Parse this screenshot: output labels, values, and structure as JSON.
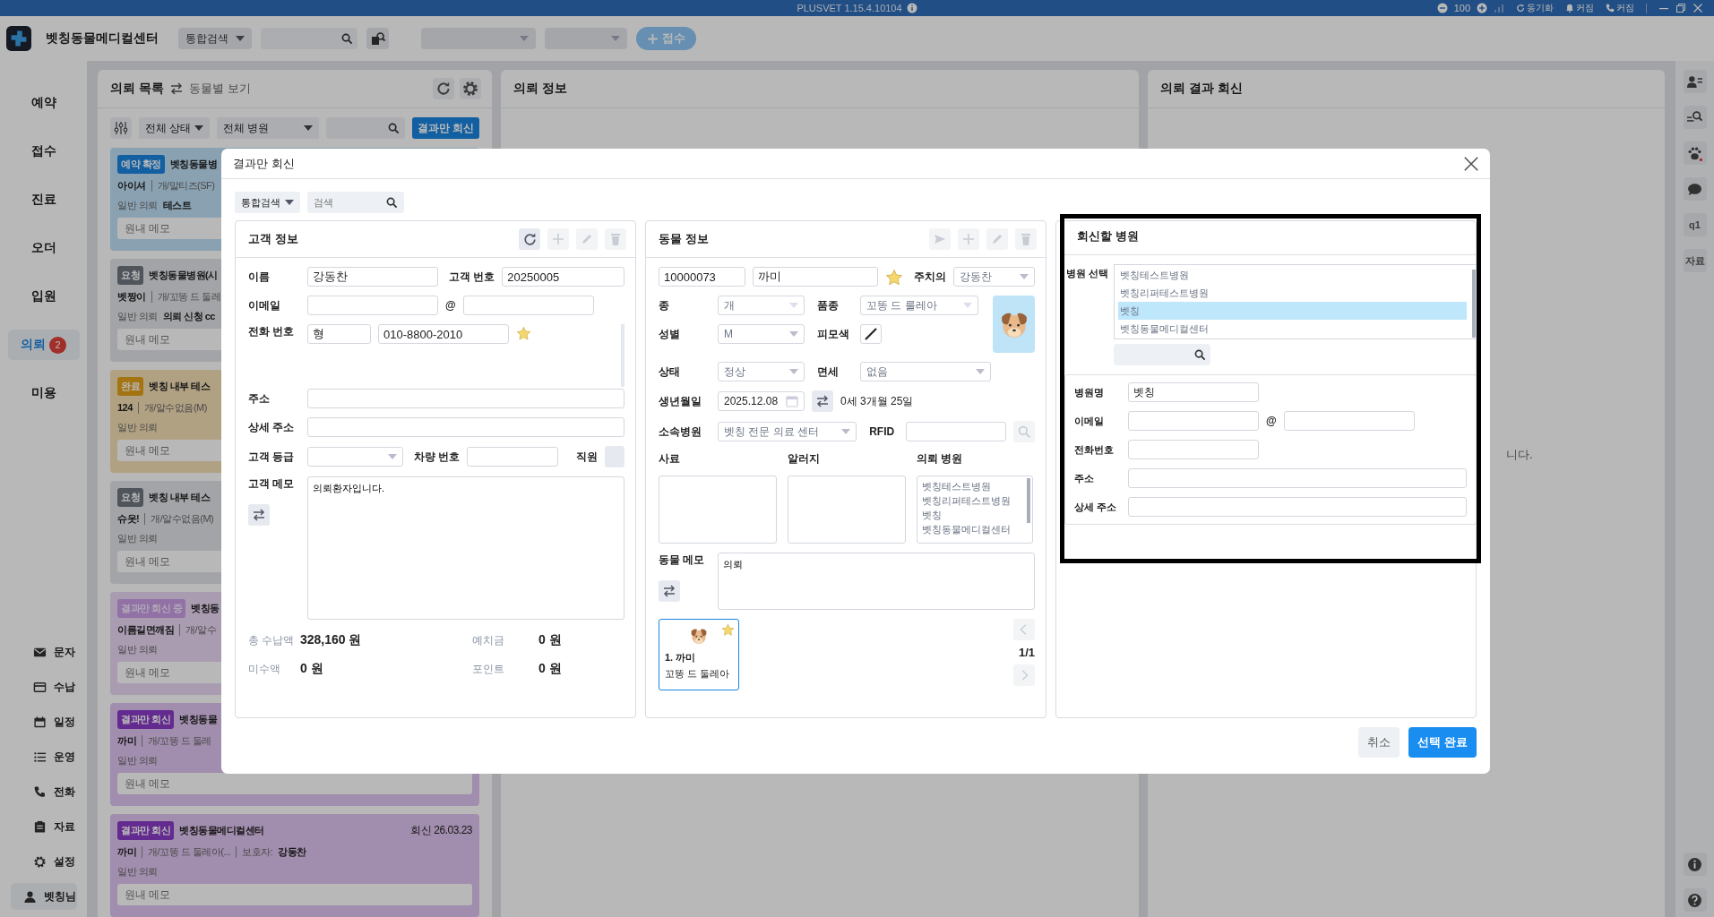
{
  "titlebar": {
    "title": "PLUSVET 1.15.4.10104",
    "zoom": "100",
    "items": [
      {
        "kind": "sync",
        "label": "동기화"
      },
      {
        "kind": "bell",
        "label": "커짐"
      },
      {
        "kind": "phone",
        "label": "커짐"
      }
    ]
  },
  "header": {
    "clinic": "벳칭동물메디컬센터",
    "search_mode": "통합검색",
    "receive_button": "접수"
  },
  "nav": {
    "items": [
      {
        "label": "예약",
        "selected": false
      },
      {
        "label": "접수",
        "selected": false
      },
      {
        "label": "진료",
        "selected": false
      },
      {
        "label": "오더",
        "selected": false
      },
      {
        "label": "입원",
        "selected": false
      },
      {
        "label": "의뢰",
        "selected": true,
        "badge": "2"
      },
      {
        "label": "미용",
        "selected": false
      }
    ],
    "tools": [
      {
        "kind": "mail",
        "label": "문자"
      },
      {
        "kind": "card",
        "label": "수납"
      },
      {
        "kind": "calendar",
        "label": "일정"
      },
      {
        "kind": "list",
        "label": "운영"
      },
      {
        "kind": "phone",
        "label": "전화"
      },
      {
        "kind": "doc",
        "label": "자료"
      },
      {
        "kind": "gear",
        "label": "설정"
      }
    ],
    "user": "벳칭님"
  },
  "list_panel": {
    "title": "의뢰 목록",
    "toggle": "동물별 보기",
    "filters": [
      "전체 상태",
      "전체 병원"
    ],
    "action": "결과만 회신",
    "cards": [
      {
        "kind": "confirmed",
        "status": "예약 확정",
        "hospital": "벳칭동물병",
        "pet": "아이셔",
        "species": "개/말티즈(SF)",
        "type": "일반 의뢰",
        "note": "테스트",
        "memo": "원내 메모"
      },
      {
        "kind": "request",
        "status": "요청",
        "hospital": "벳칭동물병원(시",
        "pet": "벳짱이",
        "species": "개/꼬똥 드 둘레",
        "type": "일반 의뢰",
        "note": "의뢰 신청 cc",
        "memo": "원내 메모"
      },
      {
        "kind": "done",
        "status": "완료",
        "hospital": "벳칭 내부 테스",
        "pet": "124",
        "species": "개/알수없음(M)",
        "type": "일반 의뢰",
        "memo": "원내 메모"
      },
      {
        "kind": "request",
        "status": "요청",
        "hospital": "벳칭 내부 테스",
        "pet": "슈웃!",
        "species": "개/알수없음(M)",
        "type": "일반 의뢰",
        "memo": "원내 메모"
      },
      {
        "kind": "pending",
        "status": "결과만 회신 중",
        "hospital": "벳칭동",
        "pet": "이름길면깨짐",
        "species": "개/알수",
        "type": "일반 의뢰",
        "memo": "원내 메모"
      },
      {
        "kind": "reply",
        "status": "결과만 회신",
        "hospital": "벳칭동물",
        "pet": "까미",
        "species": "개/꼬똥 드 둘레",
        "type": "일반 의뢰",
        "memo": "원내 메모"
      },
      {
        "kind": "reply",
        "status": "결과만 회신",
        "hospital": "벳칭동물메디컬센터",
        "date": "회신 26.03.23",
        "pet": "까미",
        "species": "개/꼬똥 드 둘레아(...",
        "owner_label": "보호자:",
        "owner": "강동찬",
        "type": "일반 의뢰",
        "memo": "원내 메모"
      }
    ]
  },
  "info_panel": {
    "title": "의뢰 정보"
  },
  "result_panel": {
    "title": "의뢰 결과 회신",
    "message": "니다."
  },
  "side_tools": [
    {
      "kind": "person"
    },
    {
      "kind": "search"
    },
    {
      "kind": "paw"
    },
    {
      "kind": "chat"
    },
    {
      "kind": "text",
      "label": "q1"
    },
    {
      "kind": "text",
      "label": "자료"
    }
  ],
  "modal": {
    "title": "결과만 회신",
    "search_mode": "통합검색",
    "search_placeholder": "검색",
    "customer": {
      "title": "고객 정보",
      "name_label": "이름",
      "name": "강동찬",
      "number_label": "고객 번호",
      "number": "20250005",
      "email_label": "이메일",
      "at": "@",
      "phone_label": "전화 번호",
      "phone_type": "형",
      "phone": "010-8800-2010",
      "phone_starred": true,
      "address_label": "주소",
      "detail_label": "상세 주소",
      "grade_label": "고객 등급",
      "car_label": "차량 번호",
      "staff_label": "직원",
      "staff_checked": false,
      "memo_label": "고객 메모",
      "memo": "의뢰환자입니다.",
      "totals": [
        {
          "label": "총 수납액",
          "value": "328,160 원"
        },
        {
          "label": "예치금",
          "value": "0 원"
        },
        {
          "label": "미수액",
          "value": "0 원"
        },
        {
          "label": "포인트",
          "value": "0 원"
        }
      ]
    },
    "animal": {
      "title": "동물 정보",
      "id": "10000073",
      "name": "까미",
      "starred": true,
      "vet_label": "주치의",
      "vet": "강동찬",
      "species_label": "종",
      "species": "개",
      "breed_label": "품종",
      "breed": "꼬똥 드 룰레아",
      "sex_label": "성별",
      "sex": "M",
      "coat_label": "피모색",
      "status_label": "상태",
      "status": "정상",
      "tax_label": "면세",
      "tax": "없음",
      "birth_label": "생년월일",
      "birth": "2025.12.08",
      "age": "0세 3개월 25일",
      "hospital_label": "소속병원",
      "hospital": "벳칭 전문 의료 센터",
      "rfid_label": "RFID",
      "feed_label": "사료",
      "allergy_label": "알러지",
      "referral_label": "의뢰 병원",
      "referrals": [
        "벳칭테스트병원",
        "벳칭리퍼테스트병원",
        "벳칭",
        "벳칭동물메디컬센터"
      ],
      "memo_label": "동물 메모",
      "memo": "의뢰",
      "pets": [
        {
          "title": "1. 까미",
          "breed": "꼬똥 드 둘레아",
          "starred": true,
          "selected": true
        }
      ],
      "pager": "1/1"
    },
    "hospital": {
      "title": "회신할 병원",
      "select_label": "병원 선택",
      "options": [
        {
          "name": "벳칭테스트병원",
          "selected": false
        },
        {
          "name": "벳칭리퍼테스트병원",
          "selected": false
        },
        {
          "name": "벳칭",
          "selected": true
        },
        {
          "name": "벳칭동물메디컬센터",
          "selected": false
        }
      ],
      "name_label": "병원명",
      "name": "벳칭",
      "email_label": "이메일",
      "at": "@",
      "phone_label": "전화번호",
      "address_label": "주소",
      "detail_label": "상세 주소"
    },
    "cancel": "취소",
    "confirm": "선택 완료"
  }
}
